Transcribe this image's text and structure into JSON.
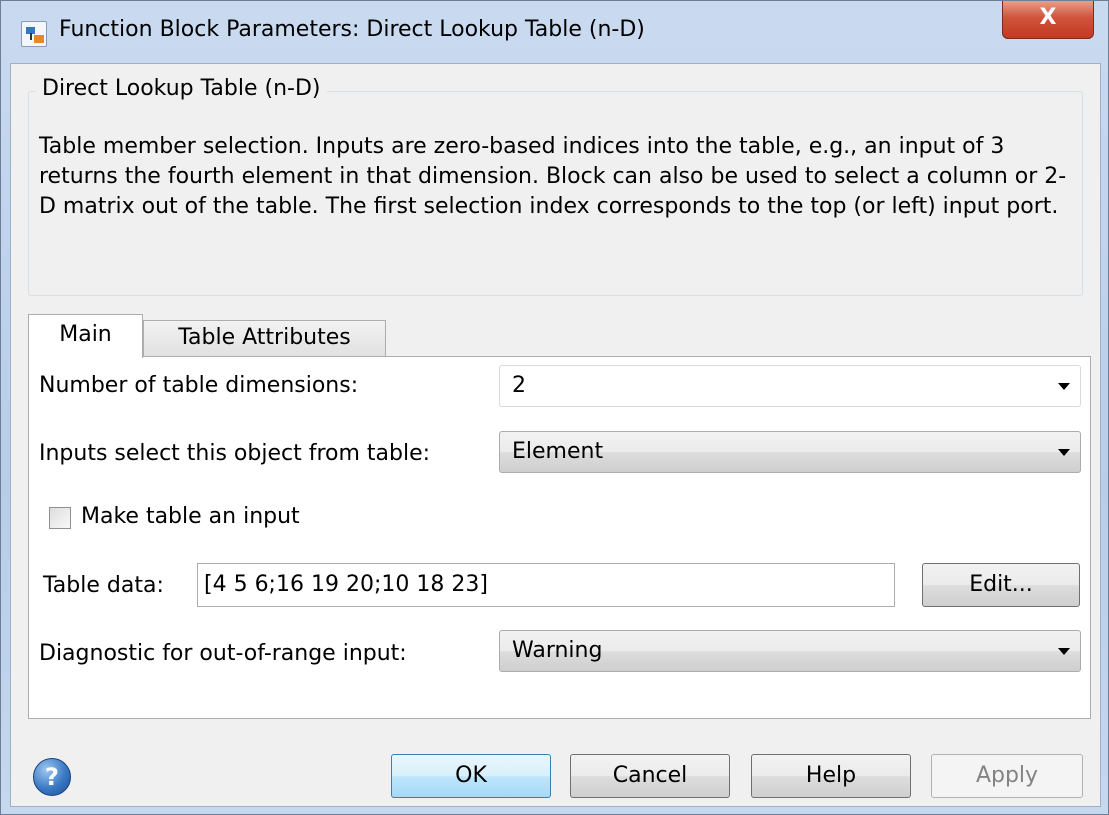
{
  "window": {
    "title": "Function Block Parameters: Direct Lookup Table (n-D)",
    "close_label": "X"
  },
  "group": {
    "title": "Direct Lookup Table (n-D)",
    "description": "Table member selection.  Inputs are zero-based indices into the table, e.g., an input of 3 returns the fourth element in that dimension. Block can also be used to select a column or 2-D matrix out of the table. The first selection index corresponds to the top (or left) input port."
  },
  "tabs": [
    {
      "label": "Main",
      "active": true
    },
    {
      "label": "Table Attributes",
      "active": false
    }
  ],
  "main": {
    "num_dims_label": "Number of table dimensions:",
    "num_dims_value": "2",
    "inputs_select_label": "Inputs select this object from table:",
    "inputs_select_value": "Element",
    "make_input_label": "Make table an input",
    "make_input_checked": false,
    "table_data_label": "Table data:",
    "table_data_value": "[4 5 6;16 19 20;10 18 23]",
    "edit_label": "Edit...",
    "diagnostic_label": "Diagnostic for out-of-range input:",
    "diagnostic_value": "Warning"
  },
  "footer": {
    "help_icon_glyph": "?",
    "ok_label": "OK",
    "cancel_label": "Cancel",
    "help_label": "Help",
    "apply_label": "Apply"
  },
  "colors": {
    "close_button": "#c23a22",
    "default_button_border": "#3c7fb1"
  },
  "icons": [
    "simulink-block-icon",
    "close-icon",
    "help-icon",
    "chevron-down-icon"
  ]
}
